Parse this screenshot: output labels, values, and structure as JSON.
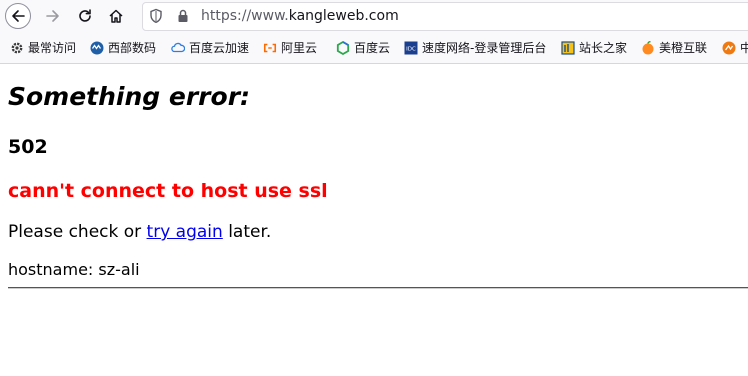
{
  "browser": {
    "url": {
      "scheme": "https://www.",
      "host": "kangleweb.com"
    },
    "bookmarks": [
      {
        "label": "最常访问",
        "icon": "gear-icon"
      },
      {
        "label": "西部数码",
        "icon": "west-digital-icon"
      },
      {
        "label": "百度云加速",
        "icon": "cloud-icon"
      },
      {
        "label": "阿里云",
        "icon": "aliyun-icon"
      },
      {
        "label": "百度云",
        "icon": "hexagon-icon"
      },
      {
        "label": "速度网络-登录管理后台",
        "icon": "idc-icon"
      },
      {
        "label": "站长之家",
        "icon": "chinaz-icon"
      },
      {
        "label": "美橙互联",
        "icon": "orange-icon"
      },
      {
        "label": "中",
        "icon": "orange-circle-icon"
      }
    ]
  },
  "page": {
    "title": "Something error:",
    "code": "502",
    "message": "cann't connect to host use ssl",
    "help_before": "Please check or ",
    "help_link": "try again",
    "help_after": " later.",
    "hostname": "hostname: sz-ali"
  },
  "colors": {
    "error_message": "#ff0000",
    "link": "#0000ee"
  }
}
